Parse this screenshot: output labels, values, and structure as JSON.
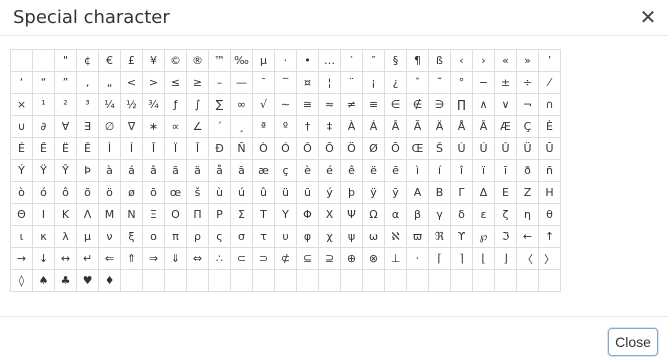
{
  "dialog": {
    "title": "Special character",
    "close_icon_glyph": "✕",
    "close_button_label": "Close"
  },
  "characters": [
    "",
    "",
    "\"",
    "¢",
    "€",
    "£",
    "¥",
    "©",
    "®",
    "™",
    "‰",
    "µ",
    "·",
    "•",
    "…",
    "′",
    "″",
    "§",
    "¶",
    "ß",
    "‹",
    "›",
    "«",
    "»",
    "’",
    "‘",
    "“",
    "”",
    "‚",
    "„",
    "<",
    ">",
    "≤",
    "≥",
    "–",
    "—",
    "¯",
    "‾",
    "¤",
    "¦",
    "¨",
    "¡",
    "¿",
    "ˆ",
    "˜",
    "°",
    "−",
    "±",
    "÷",
    "⁄",
    "×",
    "¹",
    "²",
    "³",
    "¼",
    "½",
    "¾",
    "ƒ",
    "∫",
    "∑",
    "∞",
    "√",
    "∼",
    "≅",
    "≈",
    "≠",
    "≡",
    "∈",
    "∉",
    "∋",
    "∏",
    "∧",
    "∨",
    "¬",
    "∩",
    "∪",
    "∂",
    "∀",
    "∃",
    "∅",
    "∇",
    "∗",
    "∝",
    "∠",
    "´",
    "¸",
    "ª",
    "º",
    "†",
    "‡",
    "À",
    "Á",
    "Â",
    "Ã",
    "Ä",
    "Å",
    "Ā",
    "Æ",
    "Ç",
    "È",
    "É",
    "Ê",
    "Ë",
    "Ē",
    "Ì",
    "Í",
    "Î",
    "Ï",
    "Ī",
    "Ð",
    "Ñ",
    "Ò",
    "Ó",
    "Ô",
    "Õ",
    "Ö",
    "Ø",
    "Ō",
    "Œ",
    "Š",
    "Ù",
    "Ú",
    "Û",
    "Ü",
    "Ū",
    "Ý",
    "Ÿ",
    "Ȳ",
    "Þ",
    "à",
    "á",
    "â",
    "ã",
    "ä",
    "å",
    "ā",
    "æ",
    "ç",
    "è",
    "é",
    "ê",
    "ë",
    "ē",
    "ì",
    "í",
    "î",
    "ï",
    "ī",
    "ð",
    "ñ",
    "ò",
    "ó",
    "ô",
    "õ",
    "ö",
    "ø",
    "ō",
    "œ",
    "š",
    "ù",
    "ú",
    "û",
    "ü",
    "ū",
    "ý",
    "þ",
    "ÿ",
    "ȳ",
    "Α",
    "Β",
    "Γ",
    "Δ",
    "Ε",
    "Ζ",
    "Η",
    "Θ",
    "Ι",
    "Κ",
    "Λ",
    "Μ",
    "Ν",
    "Ξ",
    "Ο",
    "Π",
    "Ρ",
    "Σ",
    "Τ",
    "Υ",
    "Φ",
    "Χ",
    "Ψ",
    "Ω",
    "α",
    "β",
    "γ",
    "δ",
    "ε",
    "ζ",
    "η",
    "θ",
    "ι",
    "κ",
    "λ",
    "μ",
    "ν",
    "ξ",
    "ο",
    "π",
    "ρ",
    "ς",
    "σ",
    "τ",
    "υ",
    "φ",
    "χ",
    "ψ",
    "ω",
    "ℵ",
    "ϖ",
    "ℜ",
    "ϒ",
    "℘",
    "ℑ",
    "←",
    "↑",
    "→",
    "↓",
    "↔",
    "↵",
    "⇐",
    "⇑",
    "⇒",
    "⇓",
    "⇔",
    "∴",
    "⊂",
    "⊃",
    "⊄",
    "⊆",
    "⊇",
    "⊕",
    "⊗",
    "⊥",
    "⋅",
    "⌈",
    "⌉",
    "⌊",
    "⌋",
    "〈",
    "〉",
    "◊",
    "♠",
    "♣",
    "♥",
    "♦",
    "",
    "",
    "",
    "",
    "",
    "",
    "",
    "",
    "",
    "",
    "",
    "",
    "",
    "",
    "",
    "",
    "",
    "",
    "",
    ""
  ]
}
